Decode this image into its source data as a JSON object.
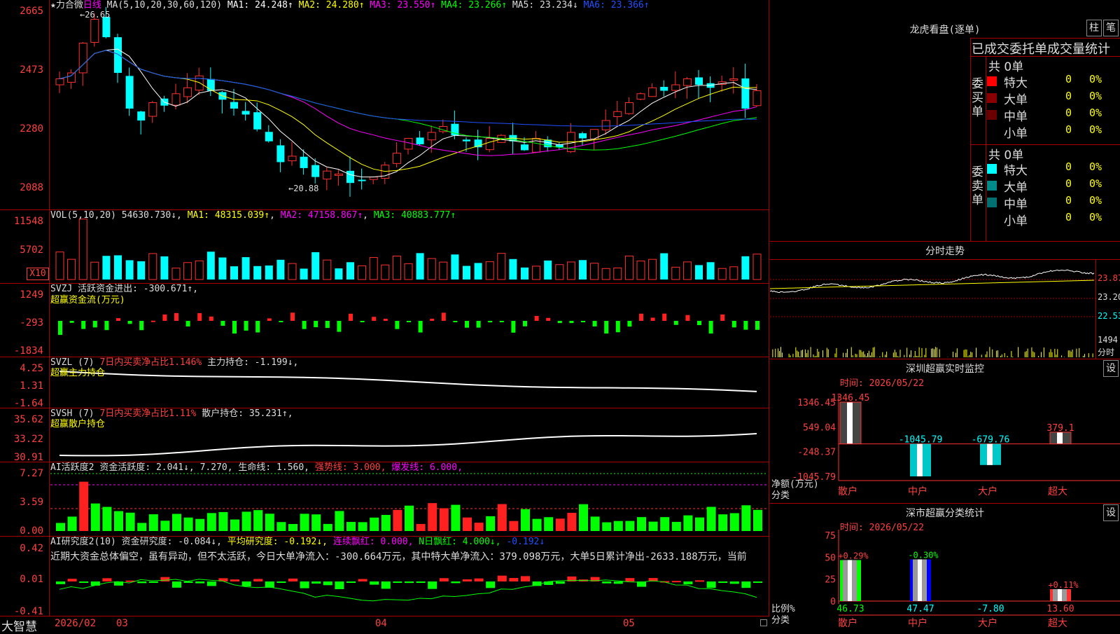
{
  "main": {
    "title": "★力合微",
    "period": "日线",
    "ma_label": "MA(5,10,20,30,60,120)",
    "ma_values": [
      {
        "label": "MA1: 24.248↑",
        "color": "#ffffff"
      },
      {
        "label": "MA2: 24.280↑",
        "color": "#ffff00"
      },
      {
        "label": "MA3: 23.550↑",
        "color": "#ff00ff"
      },
      {
        "label": "MA4: 23.266↑",
        "color": "#00ff00"
      },
      {
        "label": "MA5: 23.234↓",
        "color": "#dddddd"
      },
      {
        "label": "MA6: 23.366↑",
        "color": "#2050ff"
      }
    ],
    "y_ticks": [
      "2665",
      "2473",
      "2280",
      "2088"
    ],
    "high_label": "26.65",
    "low_label": "20.88"
  },
  "vol": {
    "header": "VOL(5,10,20)",
    "value": "54630.730↓",
    "ma1": "MA1: 48315.039↑",
    "ma2": "MA2: 47158.867↑",
    "ma3": "MA3: 40883.777↑",
    "y_ticks": [
      "11548",
      "5702"
    ],
    "unit": "X10"
  },
  "svzj": {
    "header": "SVZJ",
    "label": "活跃资金进出: -300.671↑,",
    "sub": "超赢资金流(万元)",
    "y_ticks": [
      "1249",
      "-293",
      "-1834"
    ]
  },
  "svzl": {
    "header": "SVZL (7)",
    "label1": "7日内买卖净占比1.146%",
    "label2": "主力持仓: -1.199↓,",
    "sub": "超赢主力持仓",
    "y_ticks": [
      "4.25",
      "1.31",
      "-1.64"
    ]
  },
  "svsh": {
    "header": "SVSH (7)",
    "label1": "7日内买卖净占比1.11%",
    "label2": "散户持仓: 35.231↑,",
    "sub": "超赢散户持仓",
    "y_ticks": [
      "35.62",
      "33.22",
      "30.91"
    ]
  },
  "ai1": {
    "header": "AI活跃度2",
    "label1": "资金活跃度: 2.041↓,",
    "label2": "7.270,",
    "label3": "生命线: 1.560,",
    "label4": "强势线: 3.000,",
    "label5": "爆发线: 6.000,",
    "y_ticks": [
      "7.27",
      "3.59",
      "0.00"
    ]
  },
  "ai2": {
    "header": "AI研究度2(10)",
    "label1": "资金研究度: -0.084↓,",
    "label2": "平均研究度: -0.192↓,",
    "label3": "连续飘红: 0.000,",
    "label4": "N日飘红: 4.000↓,",
    "label5": "-0.192↓",
    "comment": "近期大资金总体偏空，虽有异动，但不太活跃，今日大单净流入：-300.664万元，其中特大单净流入：379.098万元，大单5日累计净出-2633.188万元，当前",
    "y_ticks": [
      "0.42",
      "0.01",
      "-0.41"
    ]
  },
  "xaxis": {
    "logo": "大智慧",
    "labels": [
      "2026/02",
      "03",
      "04",
      "05"
    ]
  },
  "longhu": {
    "title": "龙虎看盘(逐单)",
    "btn1": "柱",
    "btn2": "笔",
    "subtitle": "已成交委托单成交量统计",
    "buy_side": "委买单",
    "sell_side": "委卖单",
    "buy_total": "共 0单",
    "sell_total": "共 0单",
    "buy_rows": [
      {
        "label": "特大",
        "count": "0",
        "pct": "0%",
        "color": "#ff0000"
      },
      {
        "label": "大单",
        "count": "0",
        "pct": "0%",
        "color": "#8b0000"
      },
      {
        "label": "中单",
        "count": "0",
        "pct": "0%",
        "color": "#6b0000"
      },
      {
        "label": "小单",
        "count": "0",
        "pct": "0%",
        "color": "#000000"
      }
    ],
    "sell_rows": [
      {
        "label": "特大",
        "count": "0",
        "pct": "0%",
        "color": "#00ffff"
      },
      {
        "label": "大单",
        "count": "0",
        "pct": "0%",
        "color": "#008b8b"
      },
      {
        "label": "中单",
        "count": "0",
        "pct": "0%",
        "color": "#007070"
      },
      {
        "label": "小单",
        "count": "0",
        "pct": "0%",
        "color": "#000000"
      }
    ]
  },
  "fenshi": {
    "title": "分时走势",
    "y_ticks": [
      "23.87",
      "23.20",
      "22.53"
    ],
    "vol_tick": "1494",
    "vol_unit": "分时"
  },
  "szjk": {
    "title": "深圳超赢实时监控",
    "settings": "设",
    "time": "时间: 2026/05/22",
    "y_ticks": [
      "1346.45",
      "549.04",
      "-248.37",
      "-1045.79"
    ],
    "y_label": "净额(万元)",
    "x_label": "分类",
    "categories": [
      "散户",
      "中户",
      "大户",
      "超大"
    ],
    "values": [
      1346.45,
      -1045.79,
      -679.76,
      379.1
    ],
    "value_labels": [
      "1346.45",
      "-1045.79",
      "-679.76",
      "379.1"
    ]
  },
  "fltj": {
    "title": "深市超赢分类统计",
    "settings": "设",
    "time": "时间: 2026/05/22",
    "y_ticks": [
      "75",
      "50",
      "25",
      "0"
    ],
    "y_label": "比例%",
    "x_label": "分类",
    "categories": [
      "散户",
      "中户",
      "大户",
      "超大"
    ],
    "top_labels": [
      "+0.29%",
      "-0.30%",
      "",
      "+0.11%"
    ],
    "values": [
      46.73,
      47.47,
      -7.8,
      13.6
    ],
    "value_labels": [
      "46.73",
      "47.47",
      "-7.80",
      "13.60"
    ]
  },
  "chart_data": [
    {
      "type": "bar",
      "title": "深圳超赢实时监控",
      "categories": [
        "散户",
        "中户",
        "大户",
        "超大"
      ],
      "values": [
        1346.45,
        -1045.79,
        -679.76,
        379.1
      ],
      "ylabel": "净额(万元)",
      "xlabel": "分类",
      "ylim": [
        -1045.79,
        1346.45
      ]
    },
    {
      "type": "bar",
      "title": "深市超赢分类统计",
      "categories": [
        "散户",
        "中户",
        "大户",
        "超大"
      ],
      "values": [
        46.73,
        47.47,
        -7.8,
        13.6
      ],
      "ylabel": "比例%",
      "xlabel": "分类",
      "ylim": [
        0,
        75
      ]
    }
  ]
}
